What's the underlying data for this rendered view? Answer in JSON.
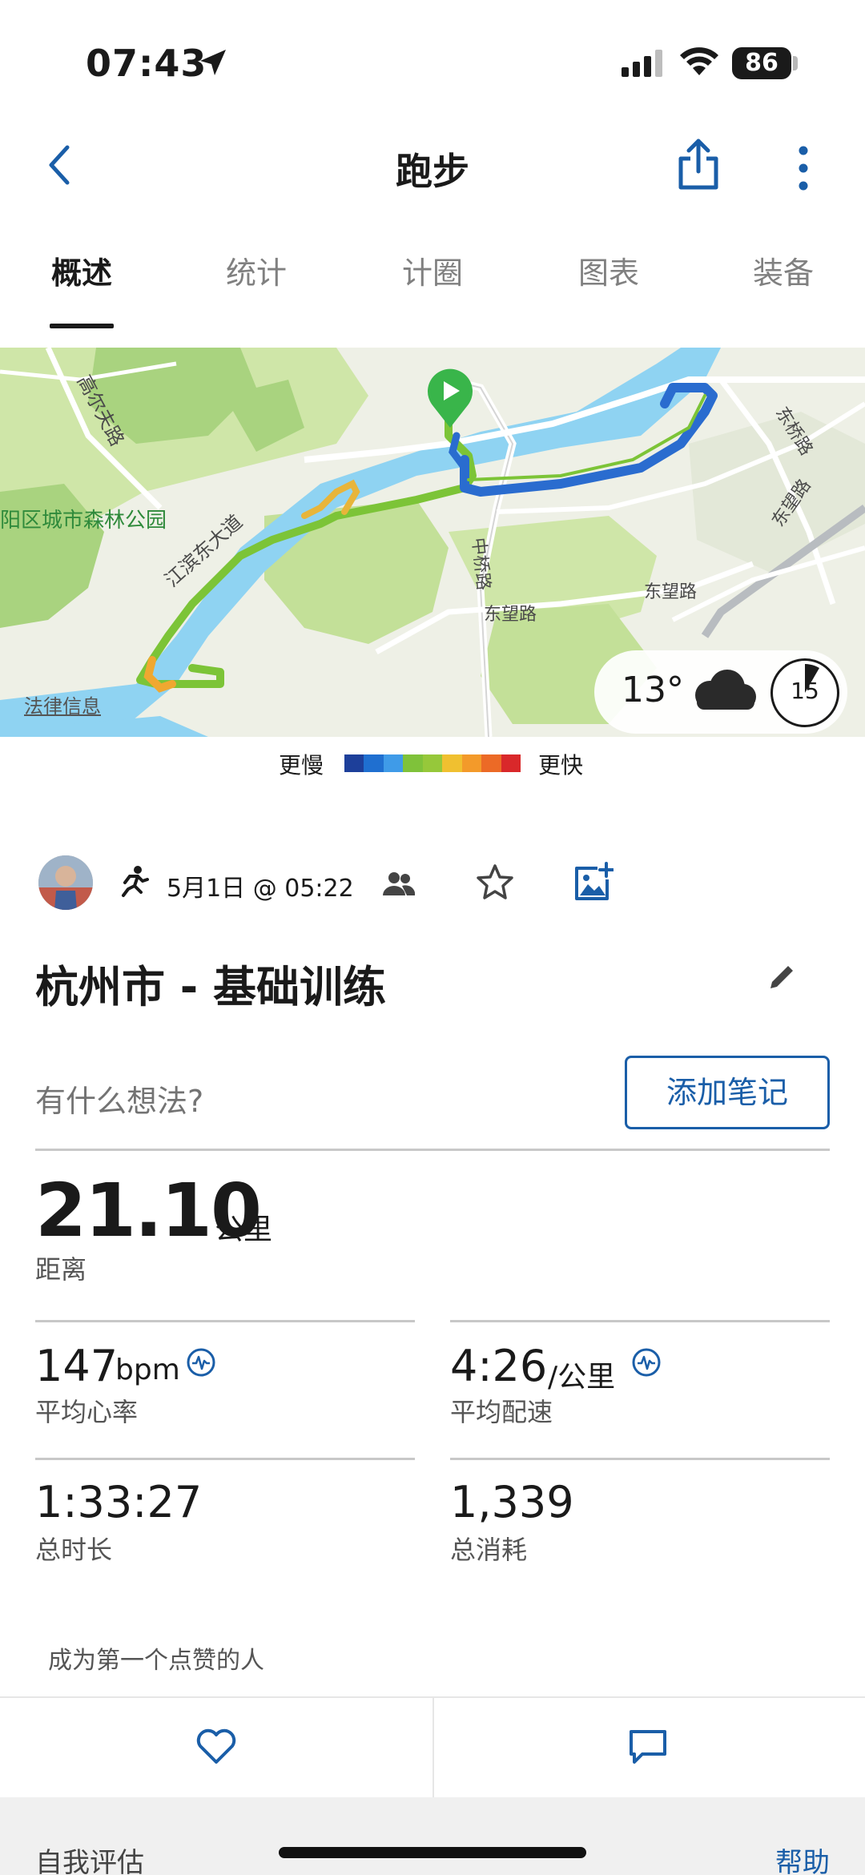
{
  "status_bar": {
    "time": "07:43",
    "battery": "86"
  },
  "nav": {
    "title": "跑步"
  },
  "tabs": [
    "概述",
    "统计",
    "计圈",
    "图表",
    "装备"
  ],
  "map": {
    "labels": {
      "road1": "高尔夫路",
      "park": "阳区城市森林公园",
      "road2": "江滨东大道",
      "road3": "中桥路",
      "road4": "东望路",
      "road5": "东望路",
      "road6": "东桥路",
      "road7": "东望路",
      "legal": "法律信息"
    },
    "weather": {
      "temp": "13°",
      "icon": "cloud-icon"
    },
    "clock_badge": "15"
  },
  "legend": {
    "slow": "更慢",
    "fast": "更快",
    "colors": [
      "#1d3f9a",
      "#1f6fd0",
      "#3f9be8",
      "#7fc23a",
      "#96c83a",
      "#f0c030",
      "#f39a2a",
      "#ec6a26",
      "#d9282a"
    ]
  },
  "activity": {
    "datetime": "5月1日 @ 05:22",
    "title": "杭州市 - 基础训练"
  },
  "notes": {
    "prompt": "有什么想法?",
    "button": "添加笔记"
  },
  "stats": {
    "distance": {
      "value": "21.10",
      "unit": "公里",
      "label": "距离"
    },
    "heart_rate": {
      "value": "147",
      "unit": "bpm",
      "label": "平均心率"
    },
    "pace": {
      "value": "4:26",
      "unit": "/公里",
      "label": "平均配速"
    },
    "duration": {
      "value": "1:33:27",
      "label": "总时长"
    },
    "calories": {
      "value": "1,339",
      "label": "总消耗"
    }
  },
  "social": {
    "likes_text": "成为第一个点赞的人"
  },
  "footer": {
    "self_eval": "自我评估",
    "help": "帮助"
  },
  "colors": {
    "accent": "#1a5ea8",
    "start_marker": "#39b54a"
  }
}
